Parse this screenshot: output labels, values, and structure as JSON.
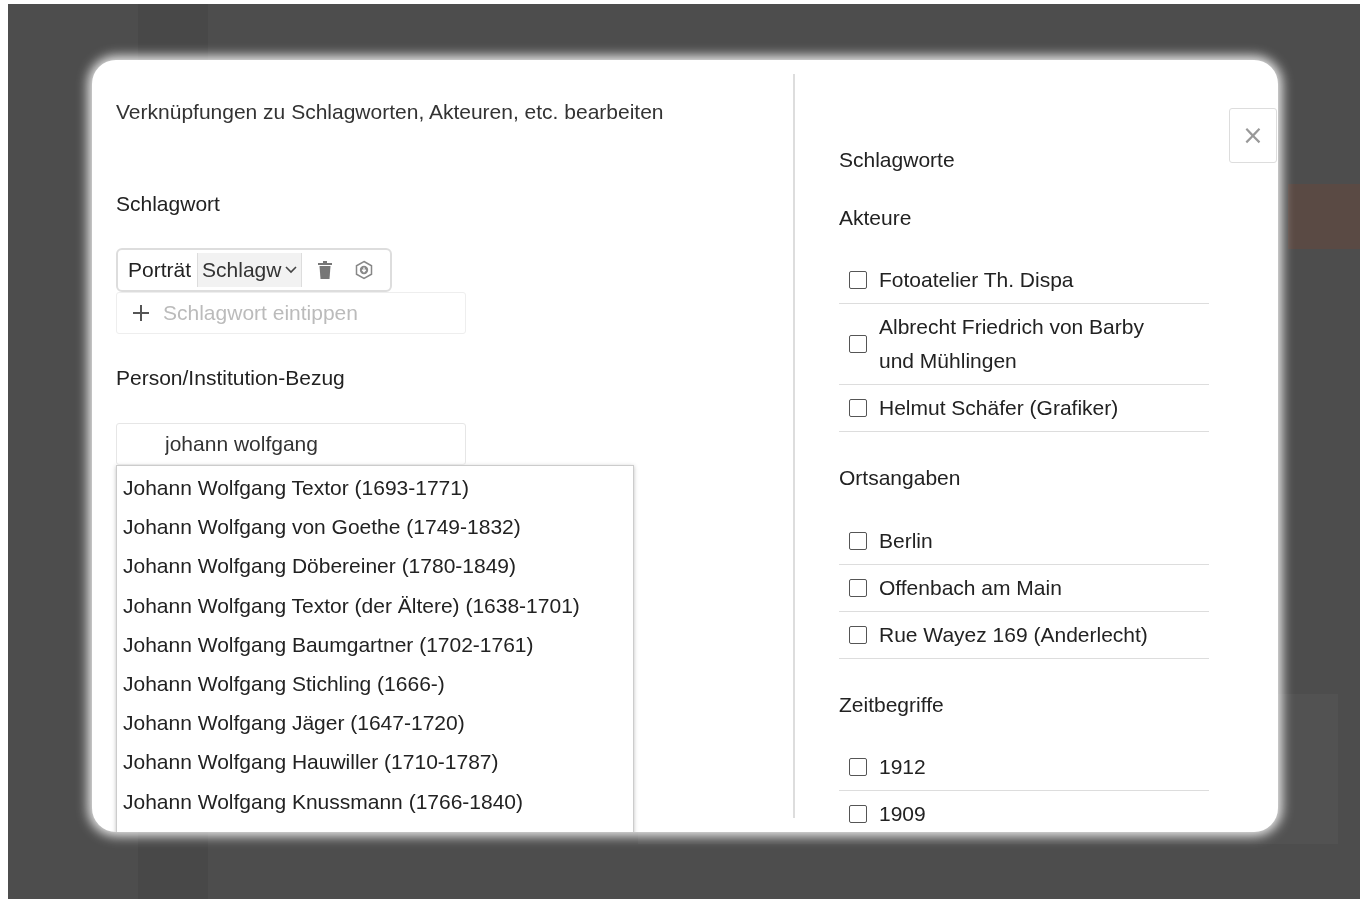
{
  "dialog": {
    "title": "Verknüpfungen zu Schlagworten, Akteuren, etc. bearbeiten",
    "close": "×"
  },
  "keyword_section": {
    "heading": "Schlagwort",
    "tags": [
      {
        "label": "Porträt",
        "type": "Schlagw"
      }
    ],
    "input": {
      "placeholder": "Schlagwort eintippen"
    }
  },
  "person_section": {
    "heading": "Person/Institution-Bezug",
    "input": {
      "value": "johann wolfgang"
    },
    "suggestions": [
      {
        "label": "Johann Wolfgang Textor (1693-1771)"
      },
      {
        "label": "Johann Wolfgang von Goethe (1749-1832)"
      },
      {
        "label": "Johann Wolfgang Döbereiner (1780-1849)"
      },
      {
        "label": "Johann Wolfgang Textor (der Ältere) (1638-1701)"
      },
      {
        "label": "Johann Wolfgang Baumgartner (1702-1761)"
      },
      {
        "label": "Johann Wolfgang Stichling (1666-)"
      },
      {
        "label": "Johann Wolfgang Jäger (1647-1720)"
      },
      {
        "label": "Johann Wolfgang Hauwiller (1710-1787)"
      },
      {
        "label": "Johann Wolfgang Knussmann (1766-1840)"
      }
    ]
  },
  "suggestion_groups": [
    {
      "heading": "Schlagworte"
    },
    {
      "heading": "Akteure",
      "items": [
        {
          "label": "Fotoatelier Th. Dispa",
          "checked": false
        },
        {
          "label": "Albrecht Friedrich von Barby und Mühlingen",
          "checked": false
        },
        {
          "label": "Helmut Schäfer (Grafiker)",
          "checked": false
        }
      ]
    },
    {
      "heading": "Ortsangaben",
      "items": [
        {
          "label": "Berlin",
          "checked": false
        },
        {
          "label": "Offenbach am Main",
          "checked": false
        },
        {
          "label": "Rue Wayez 169 (Anderlecht)",
          "checked": false
        }
      ]
    },
    {
      "heading": "Zeitbegriffe",
      "items": [
        {
          "label": "1912",
          "checked": false
        },
        {
          "label": "1909",
          "checked": false
        }
      ]
    }
  ]
}
